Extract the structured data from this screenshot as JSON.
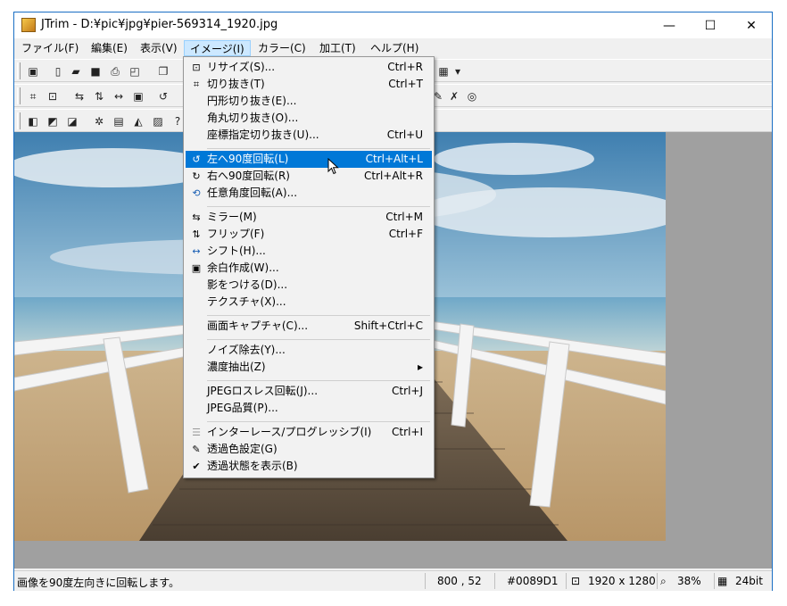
{
  "window": {
    "title": "JTrim - D:¥pic¥jpg¥pier-569314_1920.jpg"
  },
  "window_controls": {
    "minimize": "—",
    "maximize": "☐",
    "close": "✕"
  },
  "menubar": [
    {
      "label": "ファイル(F)"
    },
    {
      "label": "編集(E)"
    },
    {
      "label": "表示(V)"
    },
    {
      "label": "イメージ(I)"
    },
    {
      "label": "カラー(C)"
    },
    {
      "label": "加工(T)"
    },
    {
      "label": "ヘルプ(H)"
    }
  ],
  "image_menu": [
    {
      "label": "リサイズ(S)...",
      "shortcut": "Ctrl+R",
      "icon": "resize-icon"
    },
    {
      "label": "切り抜き(T)",
      "shortcut": "Ctrl+T",
      "icon": "crop-icon"
    },
    {
      "label": "円形切り抜き(E)...",
      "shortcut": "",
      "icon": ""
    },
    {
      "label": "角丸切り抜き(O)...",
      "shortcut": "",
      "icon": ""
    },
    {
      "label": "座標指定切り抜き(U)...",
      "shortcut": "Ctrl+U",
      "icon": ""
    },
    {
      "label": "左へ90度回転(L)",
      "shortcut": "Ctrl+Alt+L",
      "icon": "rotate-left-icon"
    },
    {
      "label": "右へ90度回転(R)",
      "shortcut": "Ctrl+Alt+R",
      "icon": "rotate-right-icon"
    },
    {
      "label": "任意角度回転(A)...",
      "shortcut": "",
      "icon": "rotate-any-icon"
    },
    {
      "label": "ミラー(M)",
      "shortcut": "Ctrl+M",
      "icon": "mirror-icon"
    },
    {
      "label": "フリップ(F)",
      "shortcut": "Ctrl+F",
      "icon": "flip-icon"
    },
    {
      "label": "シフト(H)...",
      "shortcut": "",
      "icon": "shift-icon"
    },
    {
      "label": "余白作成(W)...",
      "shortcut": "",
      "icon": "margin-icon"
    },
    {
      "label": "影をつける(D)...",
      "shortcut": "",
      "icon": ""
    },
    {
      "label": "テクスチャ(X)...",
      "shortcut": "",
      "icon": ""
    },
    {
      "label": "画面キャプチャ(C)...",
      "shortcut": "Shift+Ctrl+C",
      "icon": ""
    },
    {
      "label": "ノイズ除去(Y)...",
      "shortcut": "",
      "icon": ""
    },
    {
      "label": "濃度抽出(Z)",
      "shortcut": "▸",
      "icon": ""
    },
    {
      "label": "JPEGロスレス回転(J)...",
      "shortcut": "Ctrl+J",
      "icon": ""
    },
    {
      "label": "JPEG品質(P)...",
      "shortcut": "",
      "icon": ""
    },
    {
      "label": "インターレース/プログレッシブ(I)",
      "shortcut": "Ctrl+I",
      "icon": "interlace-icon"
    },
    {
      "label": "透過色設定(G)",
      "shortcut": "",
      "icon": "eyedropper-icon"
    },
    {
      "label": "透過状態を表示(B)",
      "shortcut": "",
      "icon": "check-icon"
    }
  ],
  "status": {
    "message": "画像を90度左向きに回転します。",
    "coords": "800 , 52",
    "color": "#0089D1",
    "size": "1920 x 1280",
    "zoom": "38%",
    "depth": "24bit"
  },
  "colors": {
    "highlight": "#0078d7",
    "menu_open": "#cce8ff"
  }
}
